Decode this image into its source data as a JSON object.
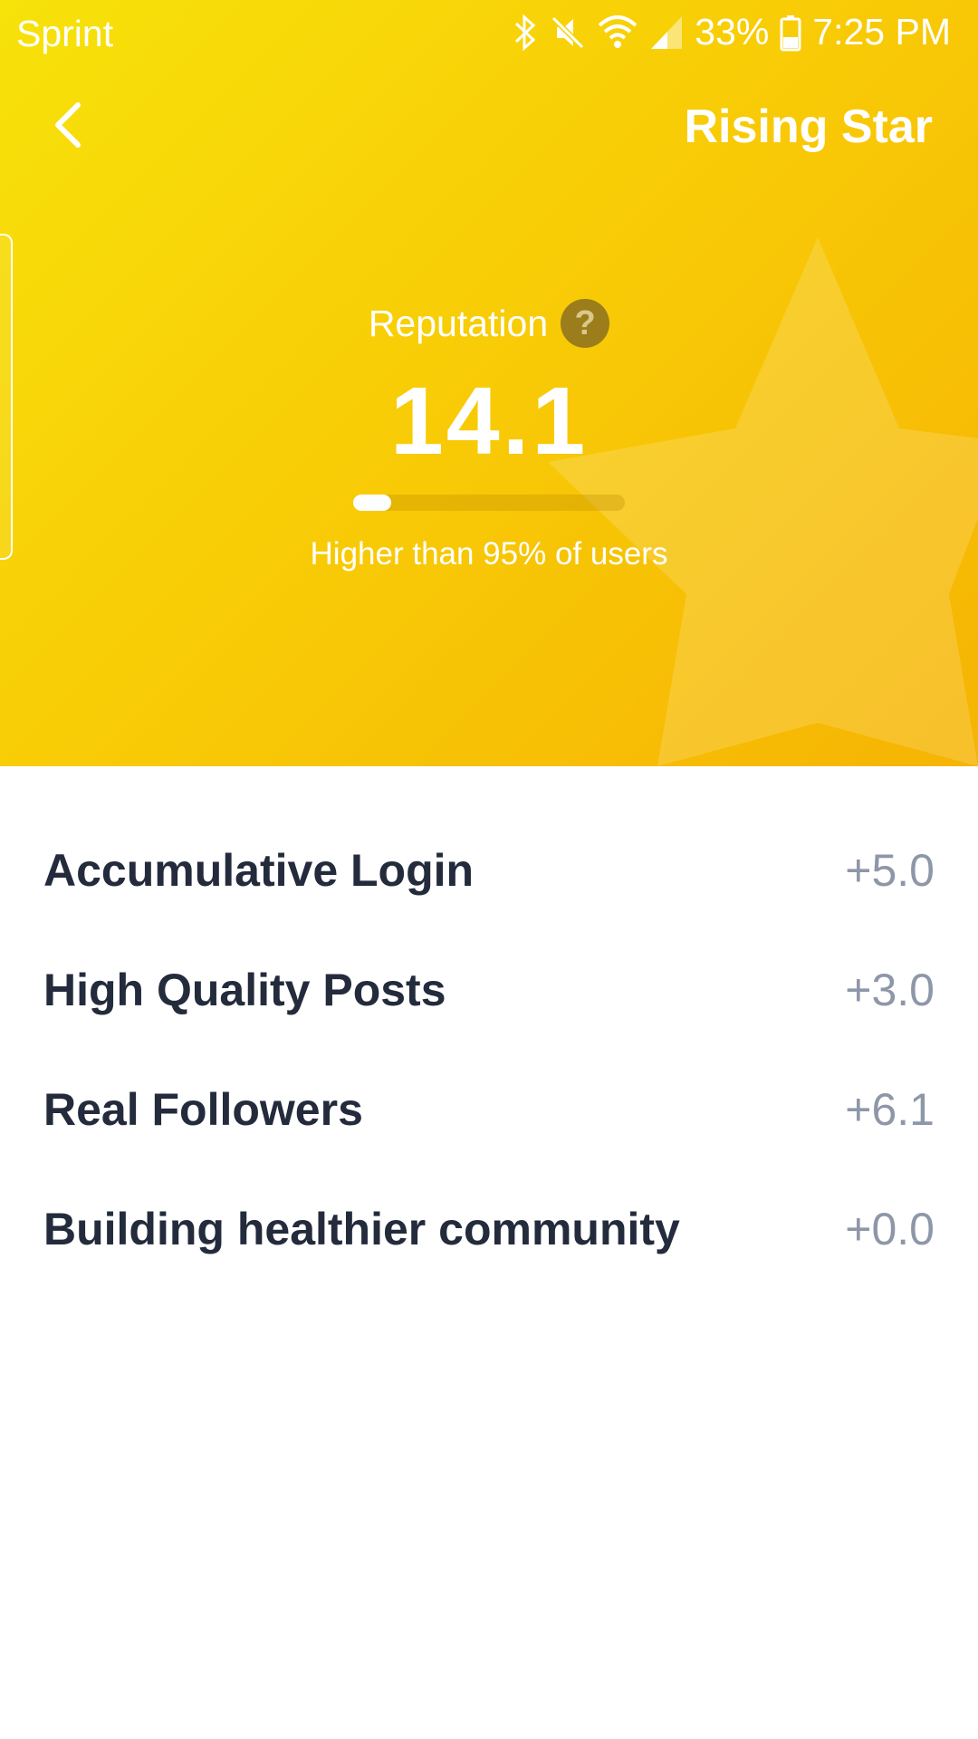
{
  "status_bar": {
    "carrier": "Sprint",
    "battery": "33%",
    "time": "7:25 PM",
    "icons": [
      "bluetooth-icon",
      "mute-icon",
      "wifi-icon",
      "signal-icon",
      "battery-icon"
    ]
  },
  "header": {
    "title": "Rising Star",
    "back_icon": "chevron-left-icon",
    "gradient_colors": [
      "#f7e20a",
      "#f8cd06",
      "#f6b404"
    ]
  },
  "reputation": {
    "label": "Reputation",
    "help_symbol": "?",
    "value": "14.1",
    "progress_fraction": 0.14,
    "percentile_text": "Higher than 95% of users"
  },
  "breakdown": [
    {
      "label": "Accumulative Login",
      "value": "+5.0"
    },
    {
      "label": "High Quality Posts",
      "value": "+3.0"
    },
    {
      "label": "Real Followers",
      "value": "+6.1"
    },
    {
      "label": "Building healthier community",
      "value": "+0.0"
    }
  ],
  "colors": {
    "item_label": "#232b3c",
    "item_value": "#8e97a8"
  }
}
